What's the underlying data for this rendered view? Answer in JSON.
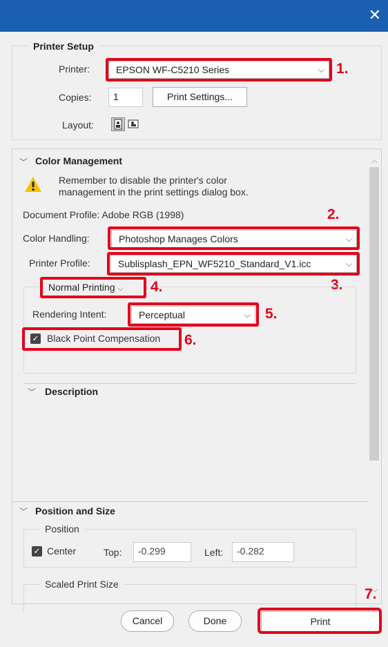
{
  "window": {
    "close_glyph": "✕"
  },
  "printer_setup": {
    "heading": "Printer Setup",
    "printer_label": "Printer:",
    "printer_value": "EPSON WF-C5210 Series",
    "copies_label": "Copies:",
    "copies_value": "1",
    "print_settings_label": "Print Settings...",
    "layout_label": "Layout:"
  },
  "color_management": {
    "heading": "Color Management",
    "warning_text_line1": "Remember to disable the printer's color",
    "warning_text_line2": "management in the print settings dialog box.",
    "document_profile": "Document Profile: Adobe RGB (1998)",
    "color_handling_label": "Color Handling:",
    "color_handling_value": "Photoshop Manages Colors",
    "printer_profile_label": "Printer Profile:",
    "printer_profile_value": "Sublisplash_EPN_WF5210_Standard_V1.icc",
    "printing_mode_value": "Normal Printing",
    "rendering_intent_label": "Rendering Intent:",
    "rendering_intent_value": "Perceptual",
    "bpc_label": "Black Point Compensation",
    "bpc_checked": true
  },
  "description": {
    "heading": "Description"
  },
  "position_size": {
    "heading": "Position and Size",
    "position_label": "Position",
    "center_label": "Center",
    "top_label": "Top:",
    "top_value": "-0.299",
    "left_label": "Left:",
    "left_value": "-0.282",
    "scaled_label": "Scaled Print Size"
  },
  "footer": {
    "cancel_label": "Cancel",
    "done_label": "Done",
    "print_label": "Print"
  },
  "annotations": {
    "n1": "1.",
    "n2": "2.",
    "n3": "3.",
    "n4": "4.",
    "n5": "5.",
    "n6": "6.",
    "n7": "7."
  },
  "colors": {
    "annotation_red": "#e3001b",
    "titlebar_blue": "#1b5fb0"
  }
}
